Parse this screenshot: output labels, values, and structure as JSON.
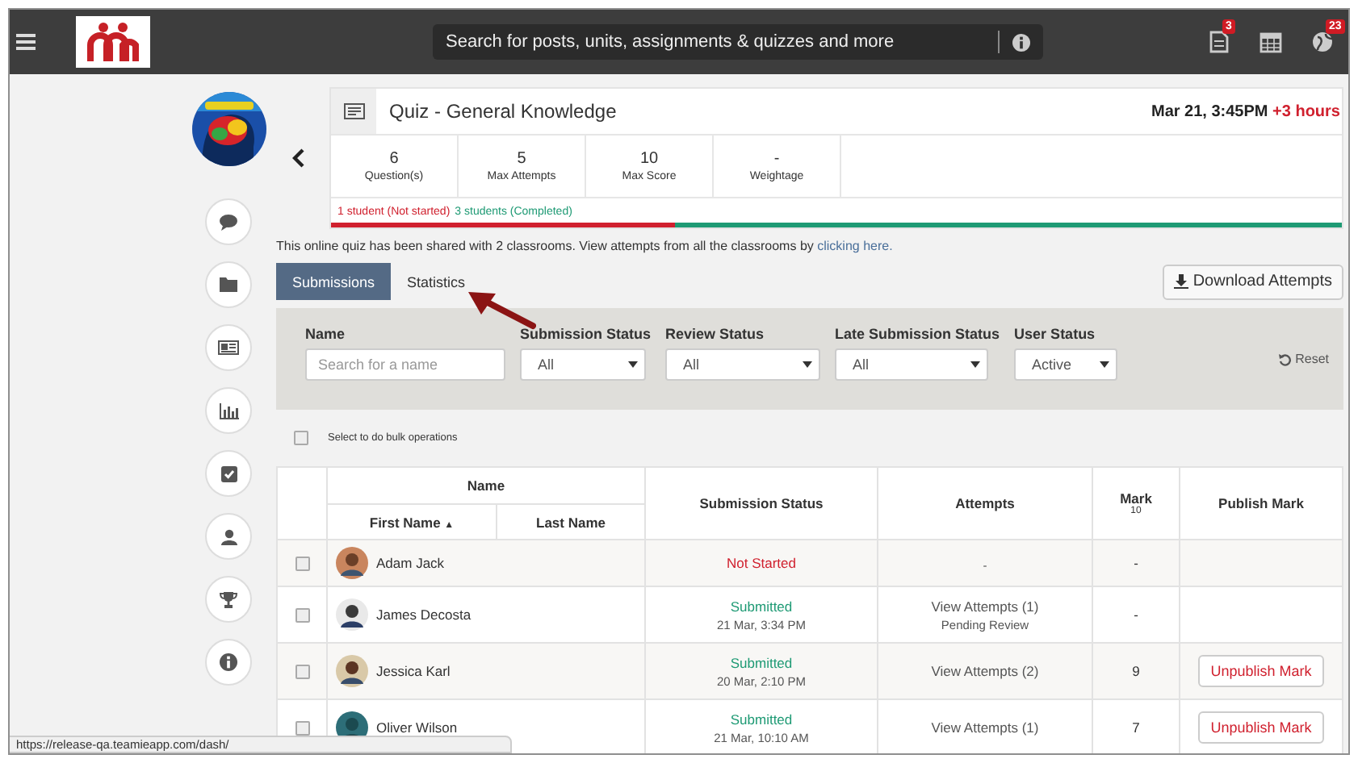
{
  "top_bar": {
    "search": {
      "placeholder": "Search for posts, units, assignments & quizzes and more"
    },
    "notifications": [
      {
        "kind": "document",
        "badge": "3"
      },
      {
        "kind": "calendar"
      },
      {
        "kind": "globe",
        "badge": "23"
      }
    ]
  },
  "sidebar": {
    "nav": [
      {
        "kind": "comment"
      },
      {
        "kind": "folder"
      },
      {
        "kind": "news"
      },
      {
        "kind": "chart"
      },
      {
        "kind": "check"
      },
      {
        "kind": "user"
      },
      {
        "kind": "trophy"
      },
      {
        "kind": "info"
      }
    ]
  },
  "quiz": {
    "title": "Quiz - General Knowledge",
    "due": "Mar 21, 3:45PM",
    "overdue": "+3 hours",
    "stats": [
      {
        "value": "6",
        "label": "Question(s)"
      },
      {
        "value": "5",
        "label": "Max Attempts"
      },
      {
        "value": "10",
        "label": "Max Score"
      },
      {
        "value": "-",
        "label": "Weightage"
      }
    ],
    "not_started": "1 student (Not started)",
    "completed": "3 students (Completed)",
    "progress": {
      "level": 0.34
    }
  },
  "share_note": {
    "text": "This online quiz has been shared with 2 classrooms. View attempts from all the classrooms by",
    "link": "clicking here."
  },
  "tabs": [
    {
      "label": "Submissions",
      "selected": true
    },
    {
      "label": "Statistics",
      "selected": false
    }
  ],
  "download_button": "Download Attempts",
  "filters": {
    "name": {
      "label": "Name",
      "placeholder": "Search for a name"
    },
    "selects": [
      {
        "label": "Submission Status",
        "value": "All"
      },
      {
        "label": "Review Status",
        "value": "All"
      },
      {
        "label": "Late Submission Status",
        "value": "All"
      },
      {
        "label": "User Status",
        "value": "Active"
      }
    ],
    "reset": "Reset"
  },
  "bulk": {
    "label": "Select to do bulk operations",
    "checked": false
  },
  "table": {
    "group_header": "Name",
    "columns": {
      "first_name": "First Name",
      "sort_indicator": "▲",
      "last_name": "Last Name",
      "submission_status": "Submission Status",
      "attempts": "Attempts",
      "mark": "Mark",
      "mark_max": "10",
      "publish": "Publish Mark"
    },
    "rows": [
      {
        "checked": false,
        "name": "Adam Jack",
        "status": {
          "kind": "not_started",
          "label": "Not Started"
        },
        "attempts": [
          {
            "kind": "text",
            "text": "-"
          }
        ],
        "mark": "-"
      },
      {
        "checked": false,
        "name": "James Decosta",
        "status": {
          "kind": "submitted",
          "label": "Submitted",
          "time": "21 Mar, 3:34 PM"
        },
        "attempts": [
          {
            "kind": "link",
            "text": "View Attempts (1)"
          },
          {
            "kind": "text",
            "text": "Pending Review"
          }
        ],
        "mark": "-"
      },
      {
        "checked": false,
        "name": "Jessica Karl",
        "status": {
          "kind": "submitted",
          "label": "Submitted",
          "time": "20 Mar, 2:10 PM"
        },
        "attempts": [
          {
            "kind": "link",
            "text": "View Attempts (2)"
          }
        ],
        "mark": "9",
        "publish_button": "Unpublish Mark"
      },
      {
        "checked": false,
        "name": "Oliver Wilson",
        "status": {
          "kind": "submitted",
          "label": "Submitted",
          "time": "21 Mar, 10:10 AM"
        },
        "attempts": [
          {
            "kind": "link",
            "text": "View Attempts (1)"
          }
        ],
        "mark": "7",
        "publish_button": "Unpublish Mark"
      }
    ]
  },
  "status_url": "https://release-qa.teamieapp.com/dash/"
}
